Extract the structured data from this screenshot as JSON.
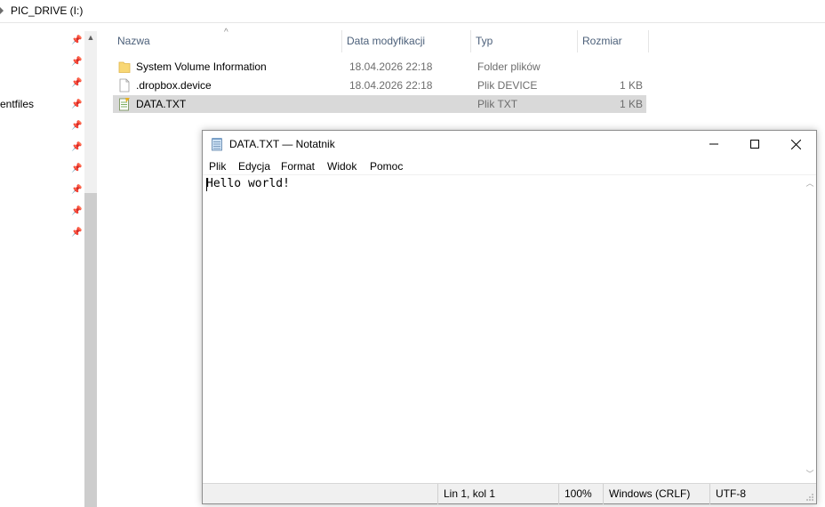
{
  "explorer": {
    "breadcrumb": "PIC_DRIVE (I:)",
    "nav_label": "entfiles",
    "columns": {
      "name": "Nazwa",
      "date": "Data modyfikacji",
      "type": "Typ",
      "size": "Rozmiar"
    },
    "files": [
      {
        "name": "System Volume Information",
        "date": "18.04.2026 22:18",
        "type": "Folder plików",
        "size": "",
        "icon": "folder-icon"
      },
      {
        "name": ".dropbox.device",
        "date": "18.04.2026 22:18",
        "type": "Plik DEVICE",
        "size": "1 KB",
        "icon": "file-icon"
      },
      {
        "name": "DATA.TXT",
        "date": "",
        "type": "Plik TXT",
        "size": "1 KB",
        "icon": "text-file-icon",
        "selected": true
      }
    ]
  },
  "notepad": {
    "title": "DATA.TXT — Notatnik",
    "menu": [
      "Plik",
      "Edycja",
      "Format",
      "Widok",
      "Pomoc"
    ],
    "content": "Hello world!",
    "status": {
      "position": "Lin 1, kol 1",
      "zoom": "100%",
      "line_ending": "Windows (CRLF)",
      "encoding": "UTF-8"
    },
    "controls": [
      "minimize-icon",
      "maximize-icon",
      "close-icon"
    ]
  },
  "colors": {
    "selected_row": "#d9d9d9",
    "header_text": "#4c607a",
    "muted_text": "#6d6d6d",
    "folder": "#f8d775"
  }
}
